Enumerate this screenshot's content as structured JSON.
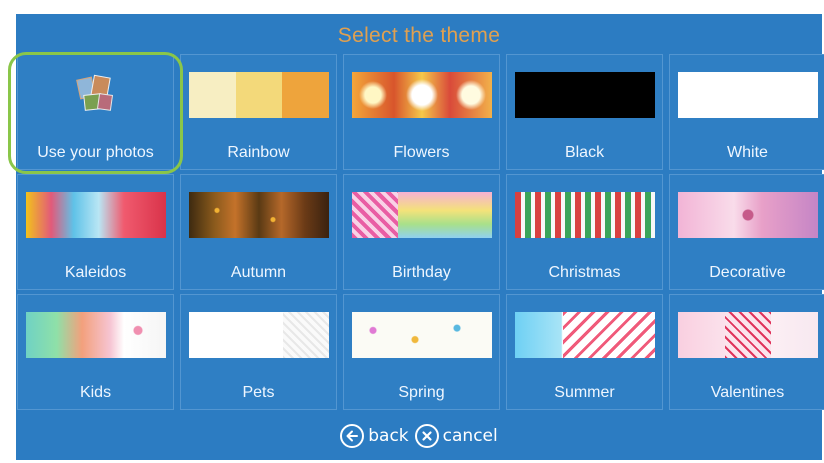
{
  "header": {
    "title": "Select the theme"
  },
  "colors": {
    "panel": "#2c7cc2",
    "title": "#e0a050",
    "highlight": "#8ac649"
  },
  "themes": [
    {
      "label": "Use your photos",
      "icon": "photo-collage-icon"
    },
    {
      "label": "Rainbow",
      "swatches": [
        "#f7eec2",
        "#f3d97a",
        "#eea43c"
      ]
    },
    {
      "label": "Flowers"
    },
    {
      "label": "Black",
      "swatches": [
        "#000000"
      ]
    },
    {
      "label": "White",
      "swatches": [
        "#ffffff"
      ]
    },
    {
      "label": "Kaleidos"
    },
    {
      "label": "Autumn"
    },
    {
      "label": "Birthday"
    },
    {
      "label": "Christmas"
    },
    {
      "label": "Decorative"
    },
    {
      "label": "Kids"
    },
    {
      "label": "Pets"
    },
    {
      "label": "Spring"
    },
    {
      "label": "Summer"
    },
    {
      "label": "Valentines"
    }
  ],
  "footer": {
    "back_label": "back",
    "cancel_label": "cancel"
  }
}
